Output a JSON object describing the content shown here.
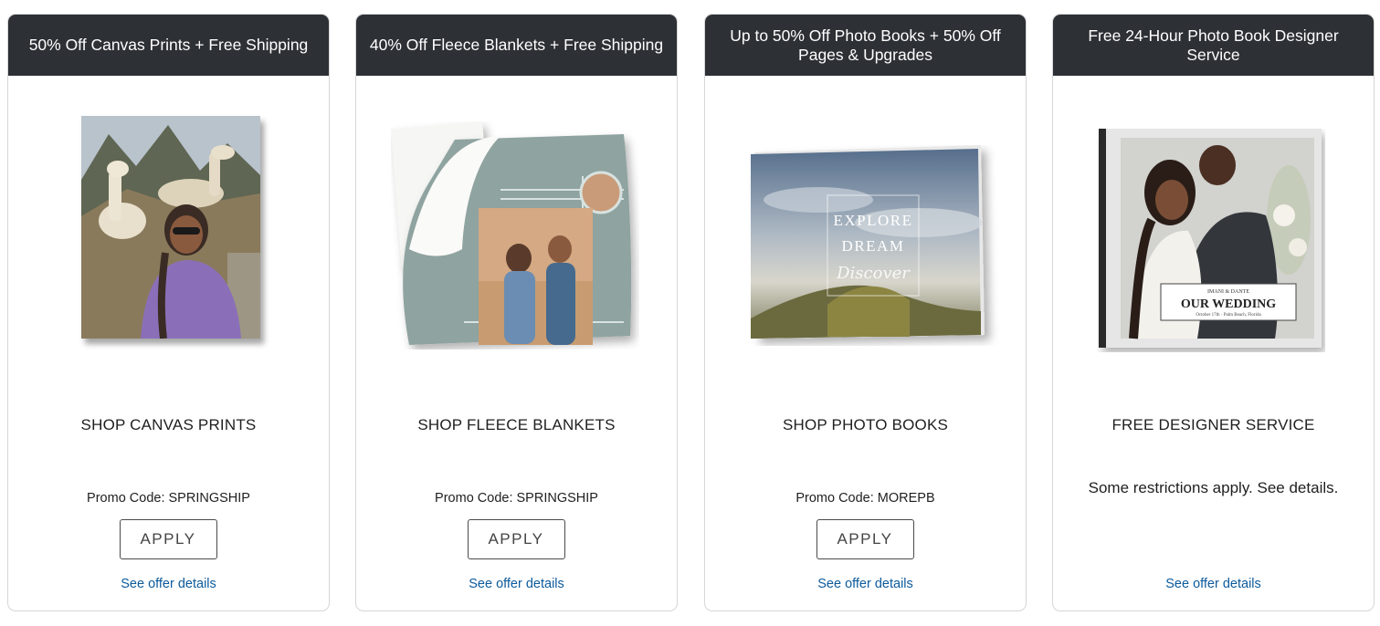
{
  "cards": [
    {
      "header": "50% Off Canvas Prints + Free Shipping",
      "product_title": "SHOP CANVAS PRINTS",
      "promo": "Promo Code: SPRINGSHIP",
      "apply_label": "APPLY",
      "details_label": "See offer details"
    },
    {
      "header": "40% Off Fleece Blankets + Free Shipping",
      "product_title": "SHOP FLEECE BLANKETS",
      "promo": "Promo Code: SPRINGSHIP",
      "apply_label": "APPLY",
      "details_label": "See offer details"
    },
    {
      "header": "Up to 50% Off Photo Books + 50% Off Pages & Upgrades",
      "product_title": "SHOP PHOTO BOOKS",
      "promo": "Promo Code: MOREPB",
      "apply_label": "APPLY",
      "details_label": "See offer details",
      "book_cover": {
        "line1": "EXPLORE",
        "line2": "DREAM",
        "line3": "Discover"
      }
    },
    {
      "header": "Free 24-Hour Photo Book Designer Service",
      "product_title": "FREE DESIGNER SERVICE",
      "restrictions": "Some restrictions apply. See details.",
      "details_label": "See offer details",
      "book_cover": {
        "names": "IMANI & DANTE",
        "title": "OUR WEDDING",
        "subline": "October 17th · Palm Beach, Florida"
      }
    }
  ],
  "colors": {
    "header_bg": "#2d3035",
    "link": "#0c5a9b",
    "card_border": "#d6d6d6"
  }
}
